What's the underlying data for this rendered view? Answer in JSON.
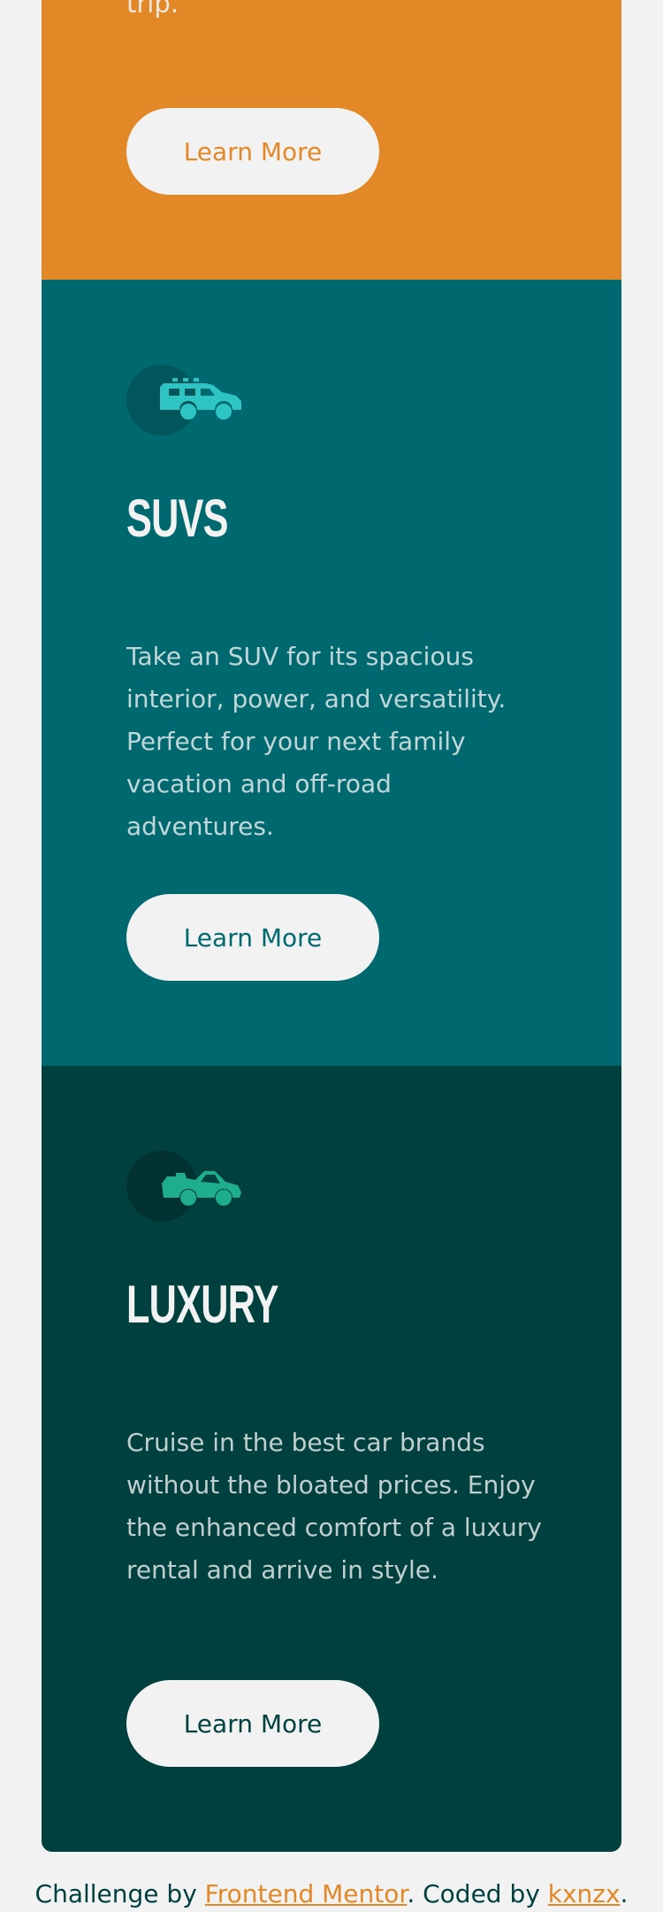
{
  "cards": {
    "sedans": {
      "text_partial": "trip.",
      "button_label": "Learn More"
    },
    "suvs": {
      "icon": "suv-car-icon",
      "title": "SUVS",
      "text": "Take an SUV for its spacious interior, power, and versatility. Perfect for your next family vacation and off-road adventures.",
      "button_label": "Learn More"
    },
    "luxury": {
      "icon": "luxury-car-icon",
      "title": "LUXURY",
      "text": "Cruise in the best car brands without the bloated prices. Enjoy the enhanced comfort of a luxury rental and arrive in style.",
      "button_label": "Learn More"
    }
  },
  "footer": {
    "prefix": "Challenge by ",
    "challenge_link": "Frontend Mentor",
    "middle": ". Coded by ",
    "author_link": "kxnzx",
    "suffix": "."
  },
  "colors": {
    "page_bg": "#f2f2f2",
    "sedans_bg": "#e38826",
    "suvs_bg": "#006970",
    "luxury_bg": "#004140",
    "suv_icon": "#2ec4c3",
    "luxury_icon": "#1fae8c"
  }
}
